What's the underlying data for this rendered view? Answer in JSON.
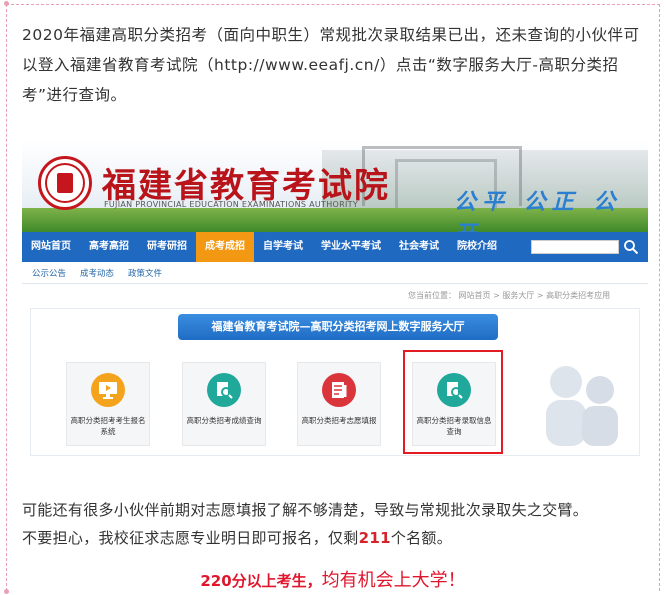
{
  "intro_text": "2020年福建高职分类招考（面向中职生）常规批次录取结果已出，还未查询的小伙伴可以登入福建省教育考试院（http://www.eeafj.cn/）点击“数字服务大厅-高职分类招考”进行查询。",
  "site": {
    "title": "福建省教育考试院",
    "subtitle": "FUJIAN PROVINCIAL EDUCATION EXAMINATIONS AUTHORITY",
    "slogan": "公平 公正 公开"
  },
  "nav": {
    "items": [
      "网站首页",
      "高考高招",
      "研考研招",
      "成考成招",
      "自学考试",
      "学业水平考试",
      "社会考试",
      "院校介绍"
    ],
    "active_index": 3
  },
  "subnav": [
    "公示公告",
    "成考动态",
    "政策文件"
  ],
  "breadcrumb": "您当前位置：    网站首页    >    服务大厅    >    高职分类招考应用",
  "service_hall": {
    "title": "福建省教育考试院—高职分类招考网上数字服务大厅",
    "cards": [
      {
        "label": "高职分类招考考生报名系统"
      },
      {
        "label": "高职分类招考成绩查询"
      },
      {
        "label": "高职分类招考志愿填报"
      },
      {
        "label": "高职分类招考录取信息查询"
      }
    ]
  },
  "para1": "可能还有很多小伙伴前期对志愿填报了解不够清楚，导致与常规批次录取失之交臂。",
  "para2": {
    "before": "不要担心，我校征求志愿专业明日即可报名，仅剩",
    "count": "211",
    "after": "个名额。"
  },
  "cta": {
    "part1": "220分以上考生，",
    "part2": "均有机会上大学！"
  },
  "colors": {
    "nav_blue": "#1f69c0",
    "nav_active": "#f39813",
    "highlight_red": "#e31b23",
    "title_red": "#b8141a"
  }
}
